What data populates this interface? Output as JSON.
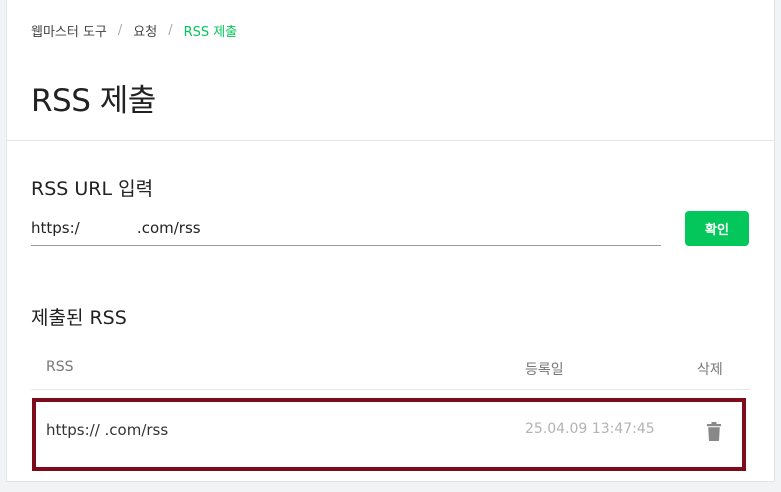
{
  "breadcrumb": {
    "items": [
      "웹마스터 도구",
      "요청",
      "RSS 제출"
    ],
    "separator": "/"
  },
  "page": {
    "title": "RSS 제출"
  },
  "url_section": {
    "label": "RSS URL 입력",
    "input_value": "https:/            .com/rss",
    "confirm_label": "확인"
  },
  "list_section": {
    "label": "제출된 RSS",
    "columns": [
      "RSS",
      "등록일",
      "삭제"
    ],
    "rows": [
      {
        "url": "https://            .com/rss",
        "date": "25.04.09 13:47:45",
        "delete_icon": "trash-icon"
      }
    ]
  },
  "colors": {
    "accent": "#03c75a",
    "highlight_border": "#7d0b1c",
    "muted_text": "#b3b3b3"
  }
}
